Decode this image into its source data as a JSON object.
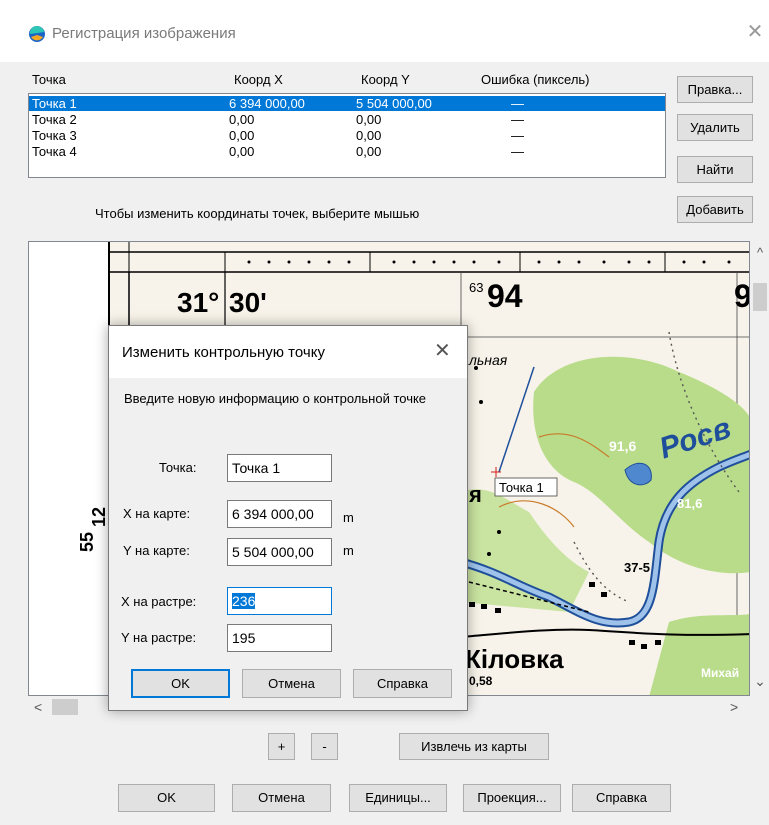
{
  "window": {
    "title": "Регистрация изображения",
    "close_glyph": "✕",
    "app_icon": "app-logo-icon"
  },
  "table": {
    "headers": [
      "Точка",
      "Коорд X",
      "Коорд Y",
      "Ошибка (пиксель)"
    ],
    "rows": [
      {
        "name": "Точка 1",
        "x": "6 394 000,00",
        "y": "5 504 000,00",
        "err": "—",
        "selected": true
      },
      {
        "name": "Точка 2",
        "x": "0,00",
        "y": "0,00",
        "err": "—",
        "selected": false
      },
      {
        "name": "Точка 3",
        "x": "0,00",
        "y": "0,00",
        "err": "—",
        "selected": false
      },
      {
        "name": "Точка 4",
        "x": "0,00",
        "y": "0,00",
        "err": "—",
        "selected": false
      }
    ]
  },
  "side_buttons": {
    "edit": "Правка...",
    "delete": "Удалить",
    "find": "Найти",
    "add": "Добавить"
  },
  "hint": "Чтобы изменить координаты точек, выберите мышью",
  "map": {
    "labels": {
      "coord_31": "31°",
      "coord_30": "30'",
      "n63": "63",
      "n94": "94",
      "n9": "9",
      "side_55": "55",
      "side_12": "12",
      "village": "Кiловка",
      "lnaya": "льная",
      "ya": "я",
      "elev_916": "91,6",
      "elev_816": "81,6",
      "elev_37": "37-5",
      "river": "Росв",
      "d058": "0,58",
      "mikhai": "Михай"
    },
    "point_label": "Точка 1",
    "colors": {
      "forest": "#b9dc8a",
      "water": "#4f88cf",
      "paper": "#f7f3ea"
    }
  },
  "scroll": {
    "up": "^",
    "down": "⌄",
    "left": "<",
    "right": ">"
  },
  "zoom": {
    "plus": "+",
    "minus": "-",
    "extract": "Извлечь из карты"
  },
  "bottom": {
    "ok": "OK",
    "cancel": "Отмена",
    "units": "Единицы...",
    "projection": "Проекция...",
    "help": "Справка"
  },
  "dialog": {
    "title": "Изменить контрольную точку",
    "close_glyph": "✕",
    "intro": "Введите новую информацию о контрольной точке",
    "point_label": "Точка:",
    "point_value": "Точка 1",
    "mapx_label": "X на карте:",
    "mapx_value": "6 394 000,00",
    "mapy_label": "Y на карте:",
    "mapy_value": "5 504 000,00",
    "unit": "m",
    "rasterx_label": "X на растре:",
    "rasterx_value": "236",
    "rastery_label": "Y на растре:",
    "rastery_value": "195",
    "ok": "OK",
    "cancel": "Отмена",
    "help": "Справка"
  }
}
